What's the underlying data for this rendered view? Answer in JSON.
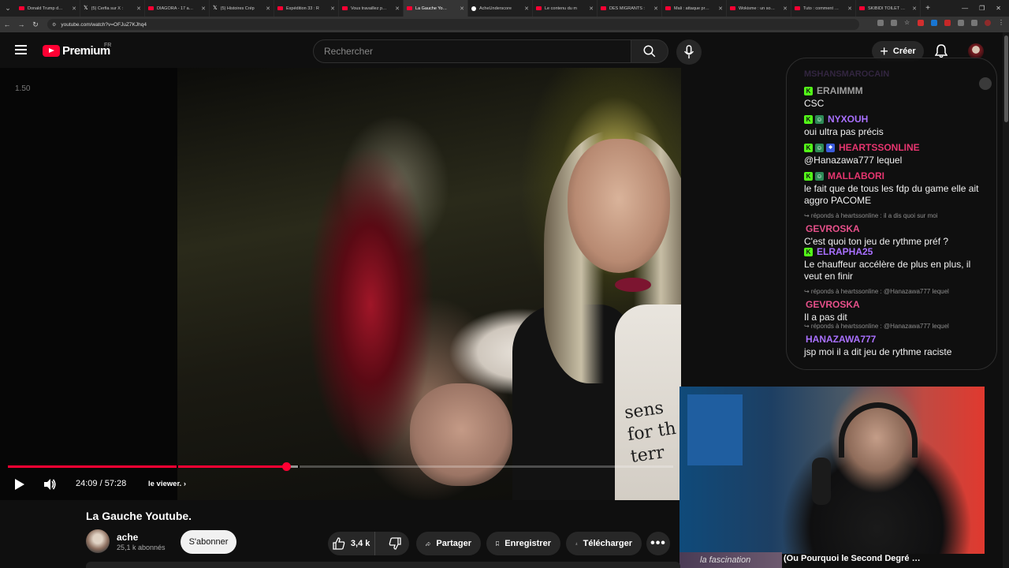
{
  "browser": {
    "tabs": [
      {
        "title": "Donald Trump d…",
        "icon": "youtube-icon"
      },
      {
        "title": "(5) Cerfia sur X :",
        "icon": "x-icon"
      },
      {
        "title": "DIAGORA - 17 a…",
        "icon": "youtube-icon"
      },
      {
        "title": "(5) Histoires Crép",
        "icon": "x-icon"
      },
      {
        "title": "Expédition 33 : R",
        "icon": "youtube-icon"
      },
      {
        "title": "Vous travaillez p…",
        "icon": "youtube-icon"
      },
      {
        "title": "La Gauche Yo…",
        "icon": "youtube-icon",
        "active": true
      },
      {
        "title": "AcheUnderscore",
        "icon": "twitch-icon"
      },
      {
        "title": "Le contenu du m",
        "icon": "youtube-icon"
      },
      {
        "title": "DES MIGRANTS :",
        "icon": "youtube-icon"
      },
      {
        "title": "Mali : attaque pr…",
        "icon": "youtube-icon"
      },
      {
        "title": "Wokisme : un so…",
        "icon": "youtube-icon"
      },
      {
        "title": "Tuto : comment …",
        "icon": "youtube-icon"
      },
      {
        "title": "SKIBIDI TOILET …",
        "icon": "youtube-icon"
      }
    ],
    "url": "youtube.com/watch?v=OFJuZ7KJhq4"
  },
  "header": {
    "logo_text": "Premium",
    "region": "FR",
    "search_placeholder": "Rechercher",
    "create_label": "Créer"
  },
  "player": {
    "zoom": "1.50",
    "current_time": "24:09 / 57:28",
    "chapter": "le viewer.",
    "progress_fraction": 0.4193,
    "buffer_fraction": 0.4364,
    "chapter_breaks": [
      0.2532,
      0.4361
    ],
    "shirt_text": "sens\nfor th\nterr",
    "colors": {
      "accent": "#ff0033"
    }
  },
  "chat": {
    "top_clip": "MSHANSMAROCAIN",
    "messages": [
      {
        "user": "ERAIMMM",
        "color": "#9e9e9e",
        "badges": [
          "k"
        ],
        "text": "CSC"
      },
      {
        "user": "NYXOUH",
        "color": "#a970ff",
        "badges": [
          "k",
          "sub"
        ],
        "text": "oui ultra pas précis"
      },
      {
        "user": "HEARTSSONLINE",
        "color": "#e6356f",
        "badges": [
          "k",
          "sub",
          "mod"
        ],
        "text": "@Hanazawa777 lequel"
      },
      {
        "user": "MALLABORI",
        "color": "#e6356f",
        "badges": [
          "k",
          "sub"
        ],
        "text": "le fait que de tous les fdp du game elle ait aggro PACOME"
      },
      {
        "user": "GEVROSKA",
        "color": "#e6508a",
        "badges": [],
        "reply": "↪ réponds à heartssonline : il a dis quoi sur moi",
        "text": "C'est quoi ton jeu de rythme préf ?"
      },
      {
        "user": "ELRAPHA25",
        "color": "#a970ff",
        "badges": [
          "k"
        ],
        "text": "Le chauffeur accélère de plus en plus, il veut en finir"
      },
      {
        "user": "GEVROSKA",
        "color": "#e6508a",
        "badges": [],
        "reply": "↪ réponds à heartssonline : @Hanazawa777 lequel",
        "text": "Il a pas dit"
      },
      {
        "user": "HANAZAWA777",
        "color": "#a970ff",
        "badges": [],
        "reply": "↪ réponds à heartssonline : @Hanazawa777 lequel",
        "text": "jsp moi il a dit jeu de rythme raciste"
      }
    ]
  },
  "webcam": {
    "caption_left": "la fascination",
    "caption_title": "(Ou Pourquoi le Second Degré …"
  },
  "video": {
    "title": "La Gauche Youtube.",
    "channel": "ache",
    "subscribers": "25,1 k abonnés",
    "subscribe_label": "S'abonner",
    "likes": "3,4 k",
    "share_label": "Partager",
    "save_label": "Enregistrer",
    "download_label": "Télécharger"
  }
}
